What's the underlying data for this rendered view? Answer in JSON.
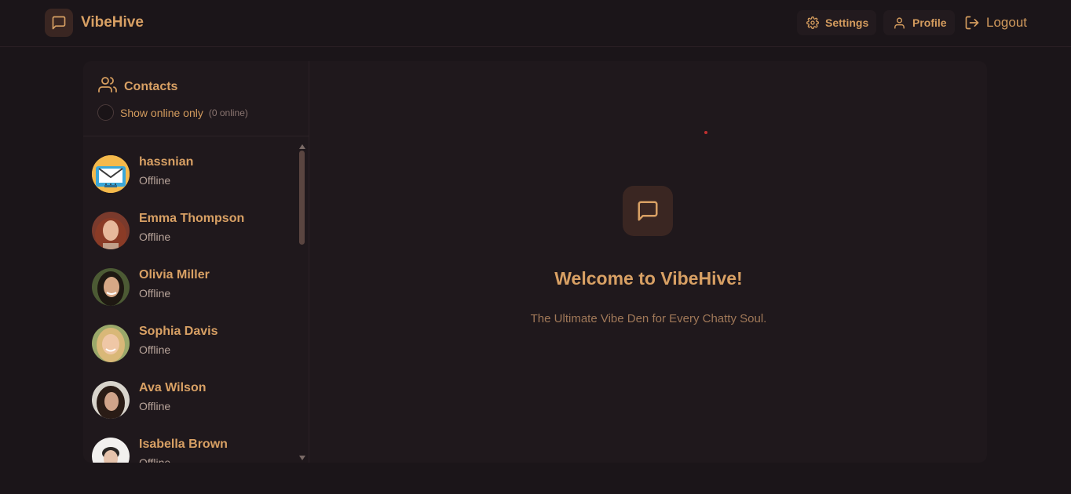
{
  "header": {
    "brand_name": "VibeHive",
    "settings_label": "Settings",
    "profile_label": "Profile",
    "logout_label": "Logout"
  },
  "sidebar": {
    "title": "Contacts",
    "online_filter_label": "Show online only",
    "online_count": "(0 online)",
    "contacts": [
      {
        "name": "hassnian",
        "status": "Offline"
      },
      {
        "name": "Emma Thompson",
        "status": "Offline"
      },
      {
        "name": "Olivia Miller",
        "status": "Offline"
      },
      {
        "name": "Sophia Davis",
        "status": "Offline"
      },
      {
        "name": "Ava Wilson",
        "status": "Offline"
      },
      {
        "name": "Isabella Brown",
        "status": "Offline"
      }
    ]
  },
  "main": {
    "welcome_title": "Welcome to VibeHive!",
    "welcome_subtitle": "The Ultimate Vibe Den for Every Chatty Soul."
  },
  "colors": {
    "background": "#1b1519",
    "accent": "#d8a064",
    "badge": "#3a2622"
  }
}
